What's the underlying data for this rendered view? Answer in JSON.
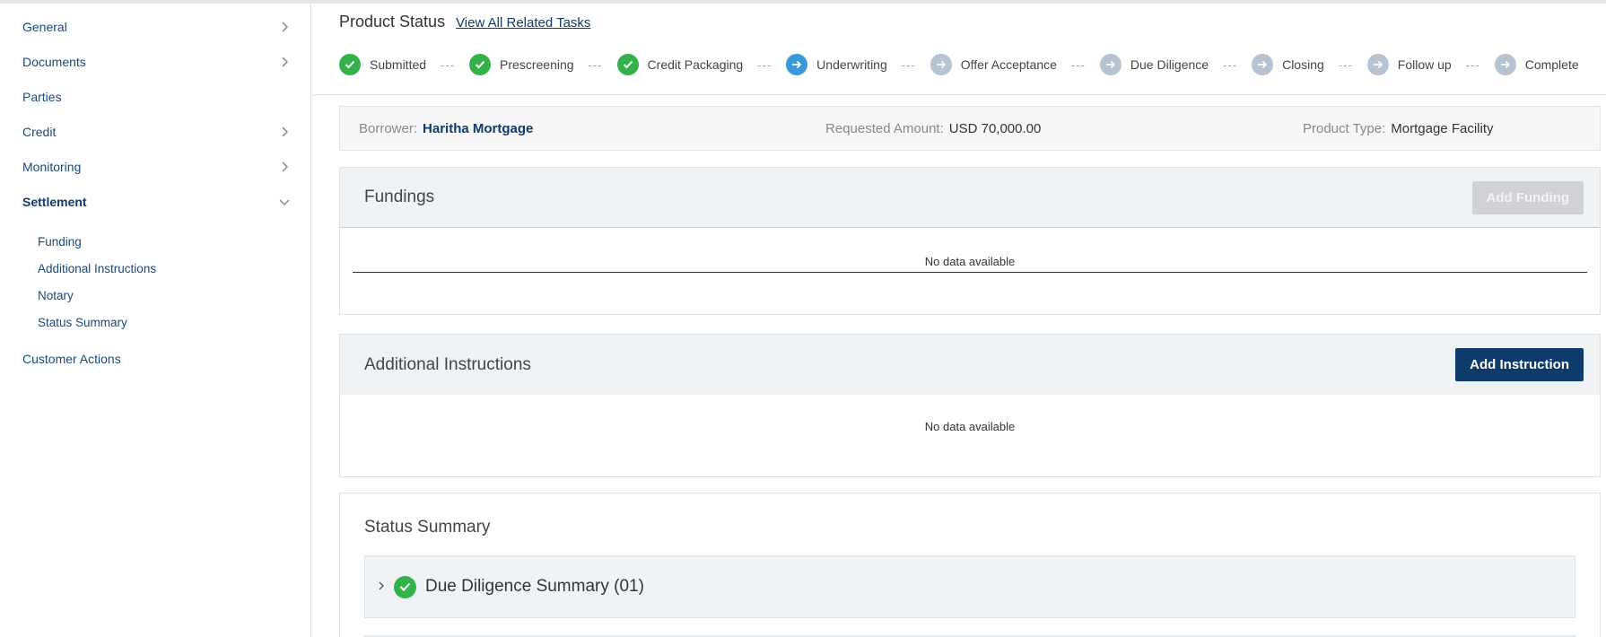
{
  "sidebar": {
    "items": [
      {
        "label": "General",
        "has_chevron": true
      },
      {
        "label": "Documents",
        "has_chevron": true
      },
      {
        "label": "Parties",
        "has_chevron": false
      },
      {
        "label": "Credit",
        "has_chevron": true
      },
      {
        "label": "Monitoring",
        "has_chevron": true
      },
      {
        "label": "Settlement",
        "has_chevron": true,
        "expanded": true
      },
      {
        "label": "Customer Actions",
        "has_chevron": false
      }
    ],
    "settlement_subitems": [
      "Funding",
      "Additional Instructions",
      "Notary",
      "Status Summary"
    ]
  },
  "product_status": {
    "title": "Product Status",
    "link": "View All Related Tasks",
    "steps": [
      {
        "label": "Submitted",
        "state": "done"
      },
      {
        "label": "Prescreening",
        "state": "done"
      },
      {
        "label": "Credit Packaging",
        "state": "done"
      },
      {
        "label": "Underwriting",
        "state": "current"
      },
      {
        "label": "Offer Acceptance",
        "state": "pending"
      },
      {
        "label": "Due Diligence",
        "state": "pending"
      },
      {
        "label": "Closing",
        "state": "pending"
      },
      {
        "label": "Follow up",
        "state": "pending"
      },
      {
        "label": "Complete",
        "state": "pending"
      }
    ],
    "separator": "---"
  },
  "info": {
    "borrower_label": "Borrower:",
    "borrower_value": "Haritha Mortgage",
    "amount_label": "Requested Amount:",
    "amount_value": "USD 70,000.00",
    "type_label": "Product Type:",
    "type_value": "Mortgage Facility"
  },
  "fundings": {
    "title": "Fundings",
    "button": "Add Funding",
    "empty": "No data available"
  },
  "instructions": {
    "title": "Additional Instructions",
    "button": "Add Instruction",
    "empty": "No data available"
  },
  "status_summary": {
    "title": "Status Summary",
    "accordion_title": "Due Diligence Summary (01)"
  },
  "colors": {
    "primary": "#0f3b6b",
    "done": "#33b24a",
    "current": "#3a9ad9",
    "pending": "#b5c3d3"
  },
  "icons": {
    "nav_chevron": "chevron-right-icon",
    "nav_expanded": "chevron-down-icon",
    "step_done": "check-icon",
    "step_pending": "arrow-right-icon"
  }
}
